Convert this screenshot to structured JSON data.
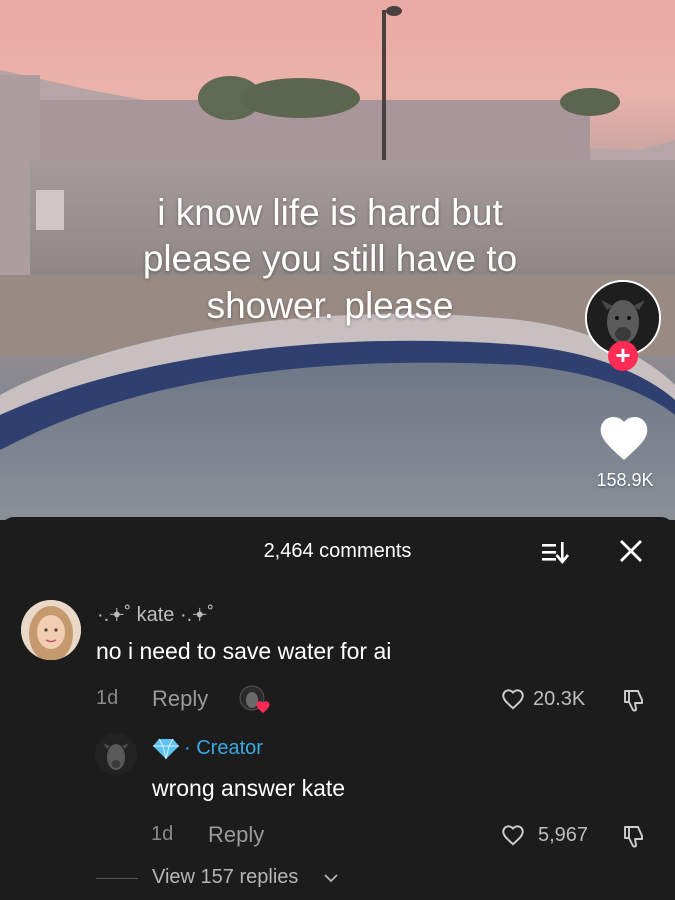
{
  "video": {
    "caption_lines": [
      "i know life is hard but",
      "please you still have to",
      "shower. please"
    ],
    "like_count": "158.9K",
    "follow_symbol": "+"
  },
  "comments_panel": {
    "count_label": "2,464 comments"
  },
  "comment": {
    "username": "·.𖥔˚ kate ·.𖥔˚",
    "text": "no i need to save water for ai",
    "age": "1d",
    "reply_label": "Reply",
    "likes": "20.3K"
  },
  "reply": {
    "creator_label": "· Creator",
    "text": "wrong answer kate",
    "age": "1d",
    "reply_label": "Reply",
    "likes": "5,967"
  },
  "view_replies": {
    "label": "View 157 replies"
  },
  "colors": {
    "accent_red": "#fe2c55",
    "creator_blue": "#3aa9e2",
    "panel_bg": "#1c1c1c"
  },
  "icons": [
    "heart-icon",
    "sort-icon",
    "close-icon",
    "plus-icon",
    "dislike-icon",
    "diamond-icon",
    "chevron-down-icon"
  ]
}
